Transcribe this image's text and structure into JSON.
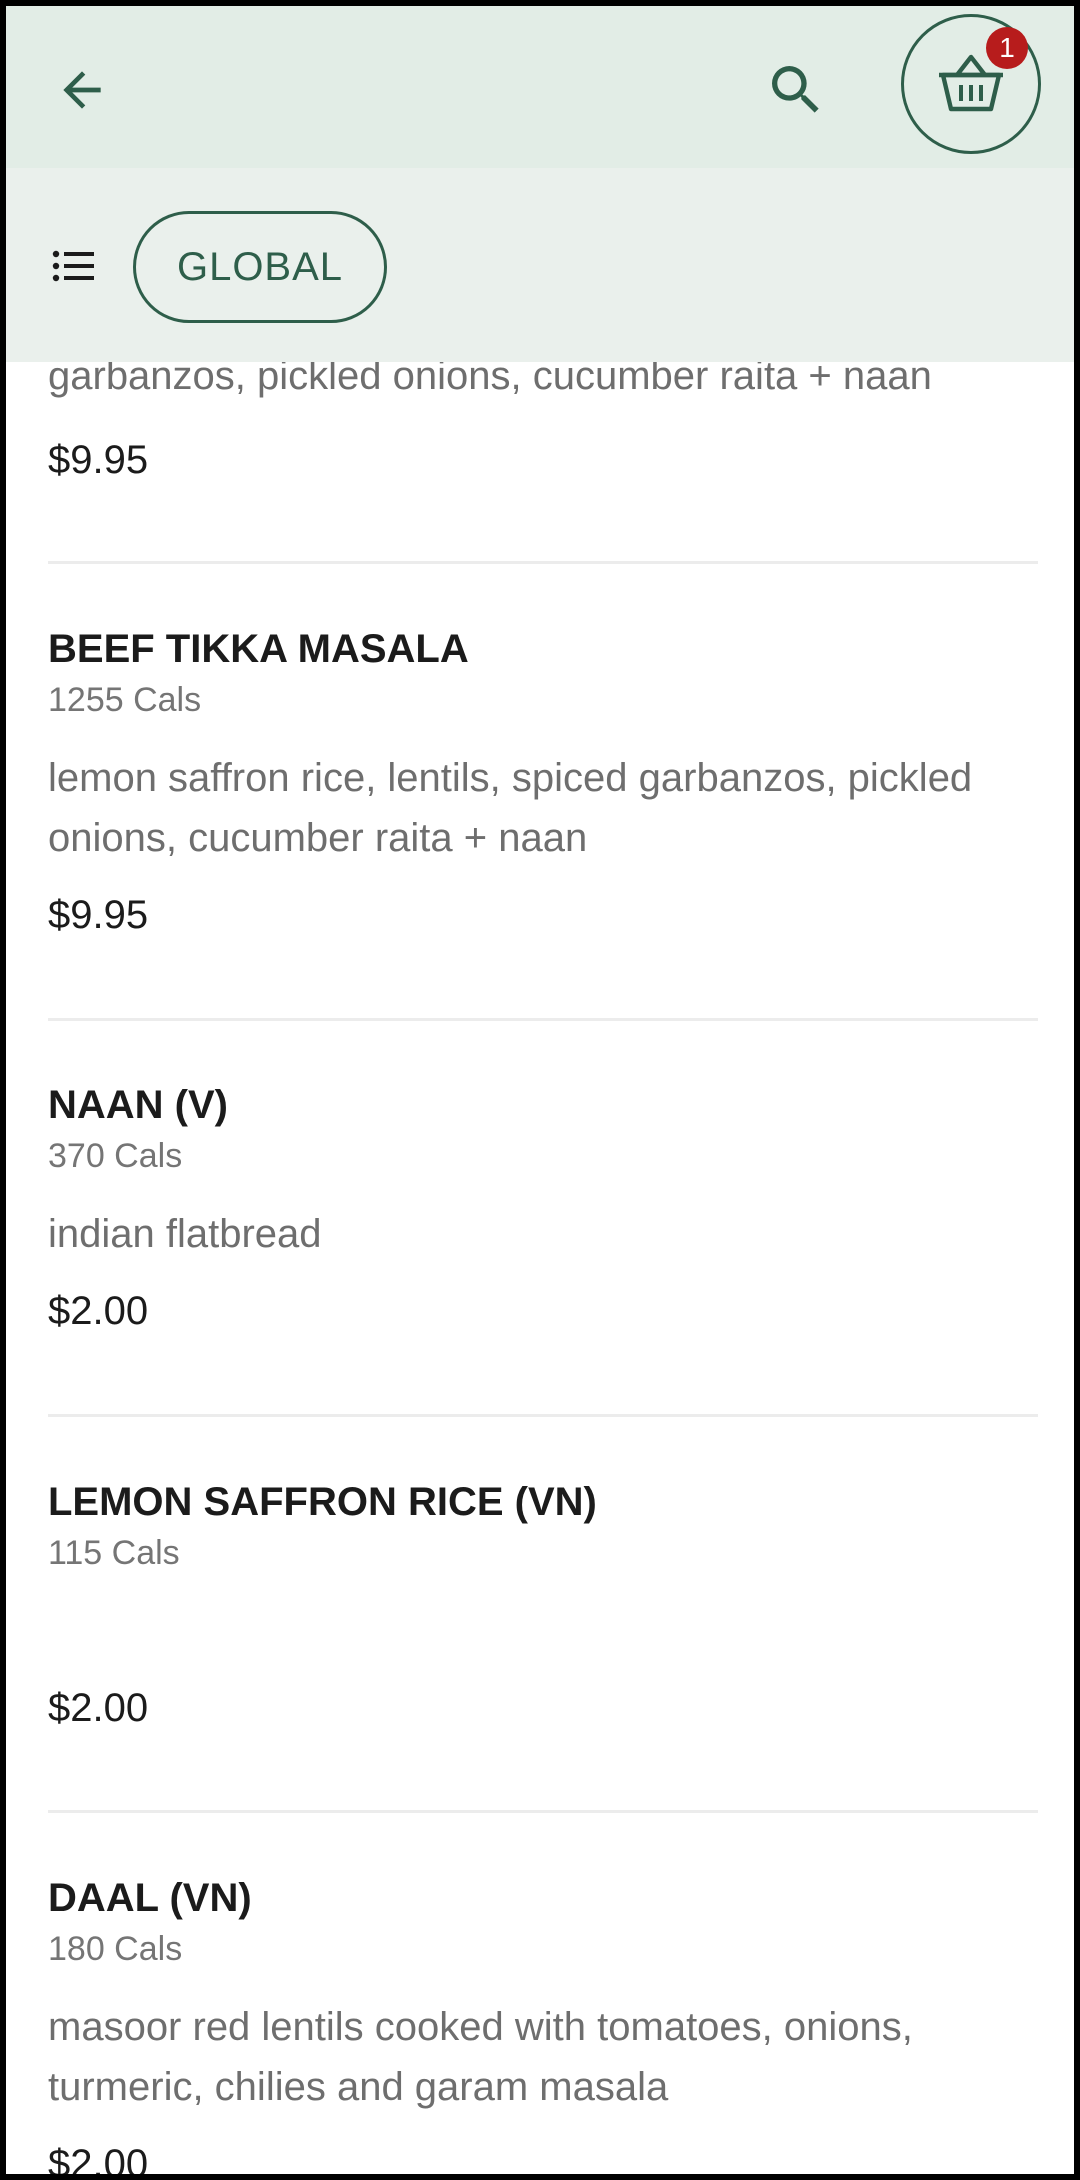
{
  "header": {
    "back_icon": "arrow-left-icon",
    "search_icon": "search-icon",
    "cart_icon": "basket-icon",
    "cart_count": "1",
    "accent_color": "#2e5e4a",
    "badge_color": "#b71c1c"
  },
  "filter": {
    "list_icon": "list-icon",
    "category_label": "GLOBAL"
  },
  "items": [
    {
      "desc": "garbanzos, pickled onions, cucumber raita + naan",
      "price": "$9.95"
    },
    {
      "name": "BEEF TIKKA MASALA",
      "cals": "1255 Cals",
      "desc": "lemon saffron rice, lentils, spiced garbanzos, pickled onions, cucumber raita + naan",
      "price": "$9.95"
    },
    {
      "name": "NAAN (V)",
      "cals": "370 Cals",
      "desc": "indian flatbread",
      "price": "$2.00"
    },
    {
      "name": "LEMON SAFFRON RICE (VN)",
      "cals": "115 Cals",
      "desc": "",
      "price": "$2.00"
    },
    {
      "name": "DAAL (VN)",
      "cals": "180 Cals",
      "desc": "masoor red lentils cooked with tomatoes, onions, turmeric, chilies and garam masala",
      "price": "$2.00"
    }
  ]
}
